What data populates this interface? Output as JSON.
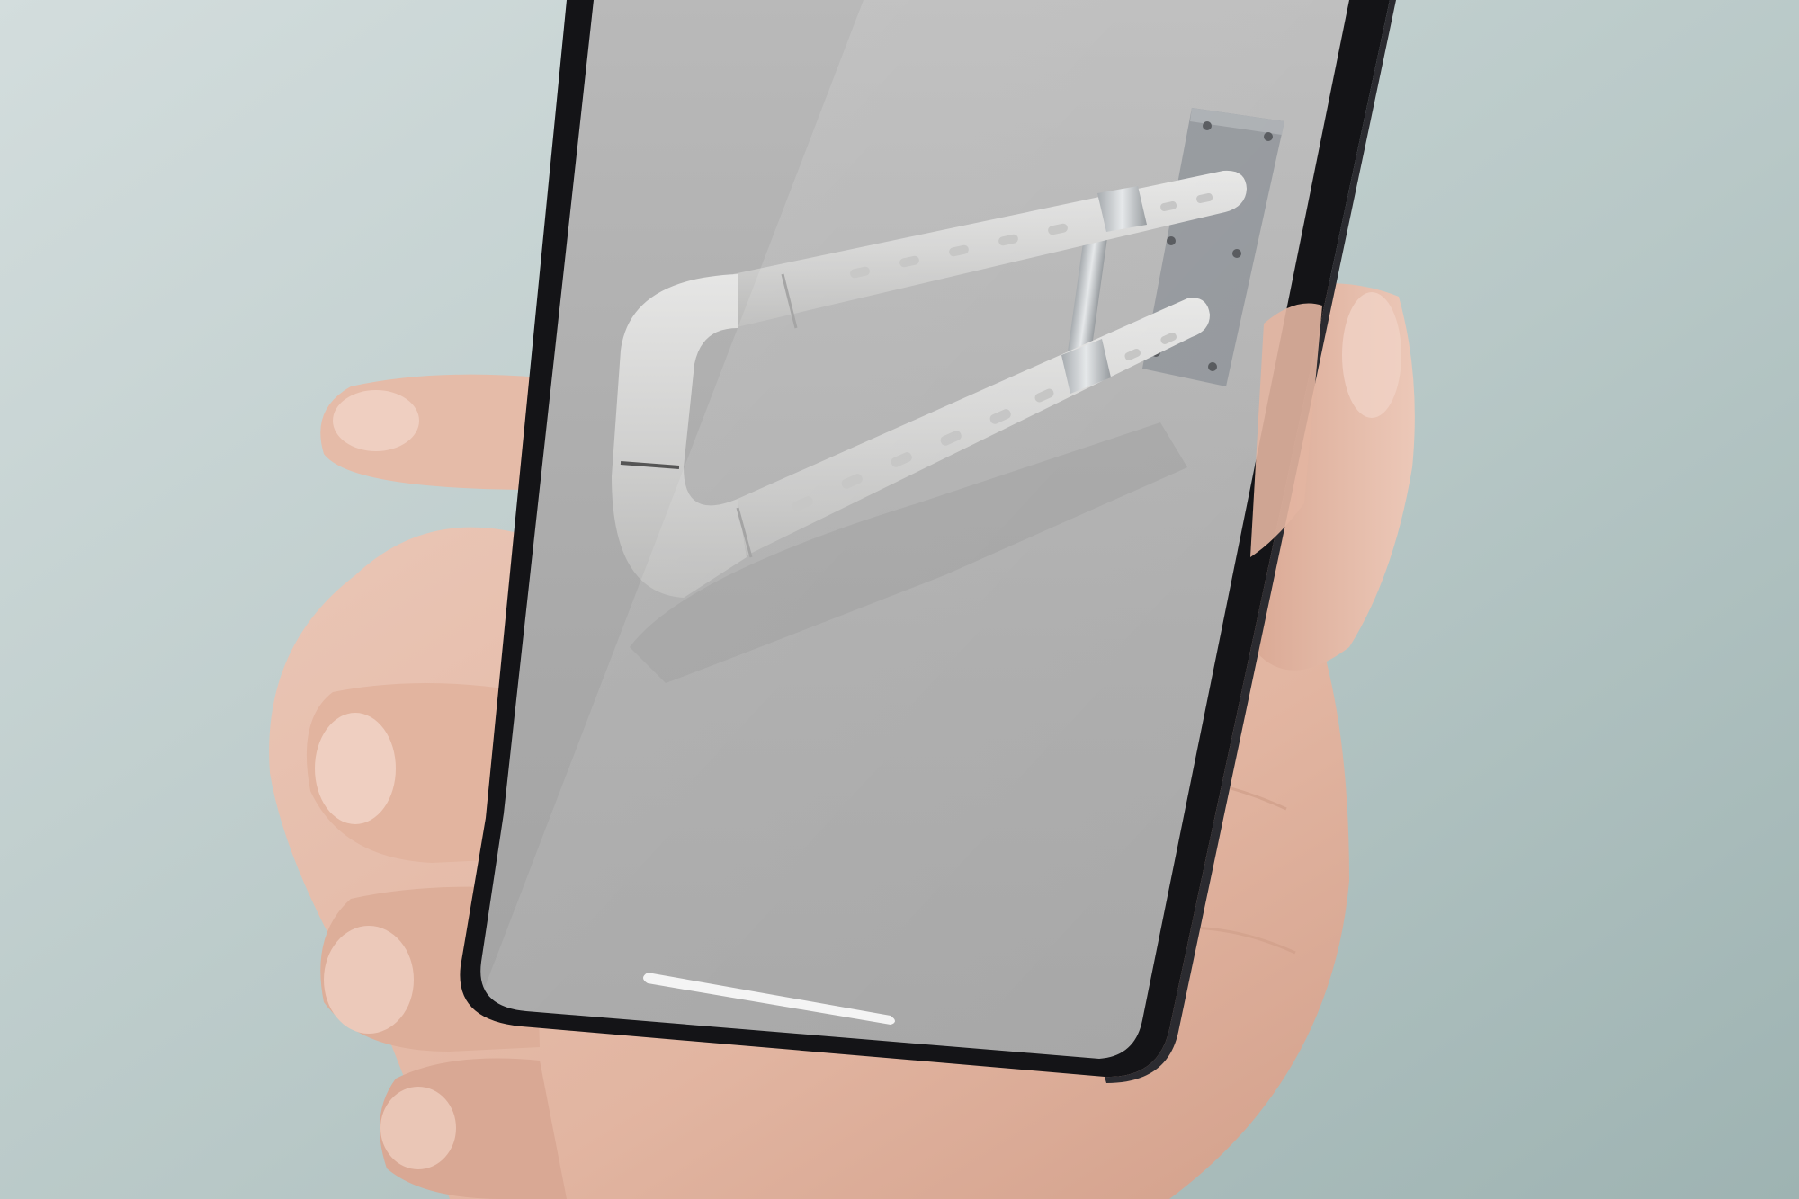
{
  "colors": {
    "backdrop": "#b9c9c8",
    "phone_frame": "#17171a",
    "screen_top": "#b4b4b4",
    "screen_bottom": "#a6a6a6",
    "skin": "#e4b9a6",
    "skin_shadow": "#c89583",
    "grab_bar_plastic": "#d7d7d6",
    "grab_bar_metal": "#bfc2c4",
    "wall_plate": "#8e9297",
    "home_indicator": "#f4f4f4"
  },
  "icons": {
    "home_indicator": "home-indicator-bar"
  }
}
